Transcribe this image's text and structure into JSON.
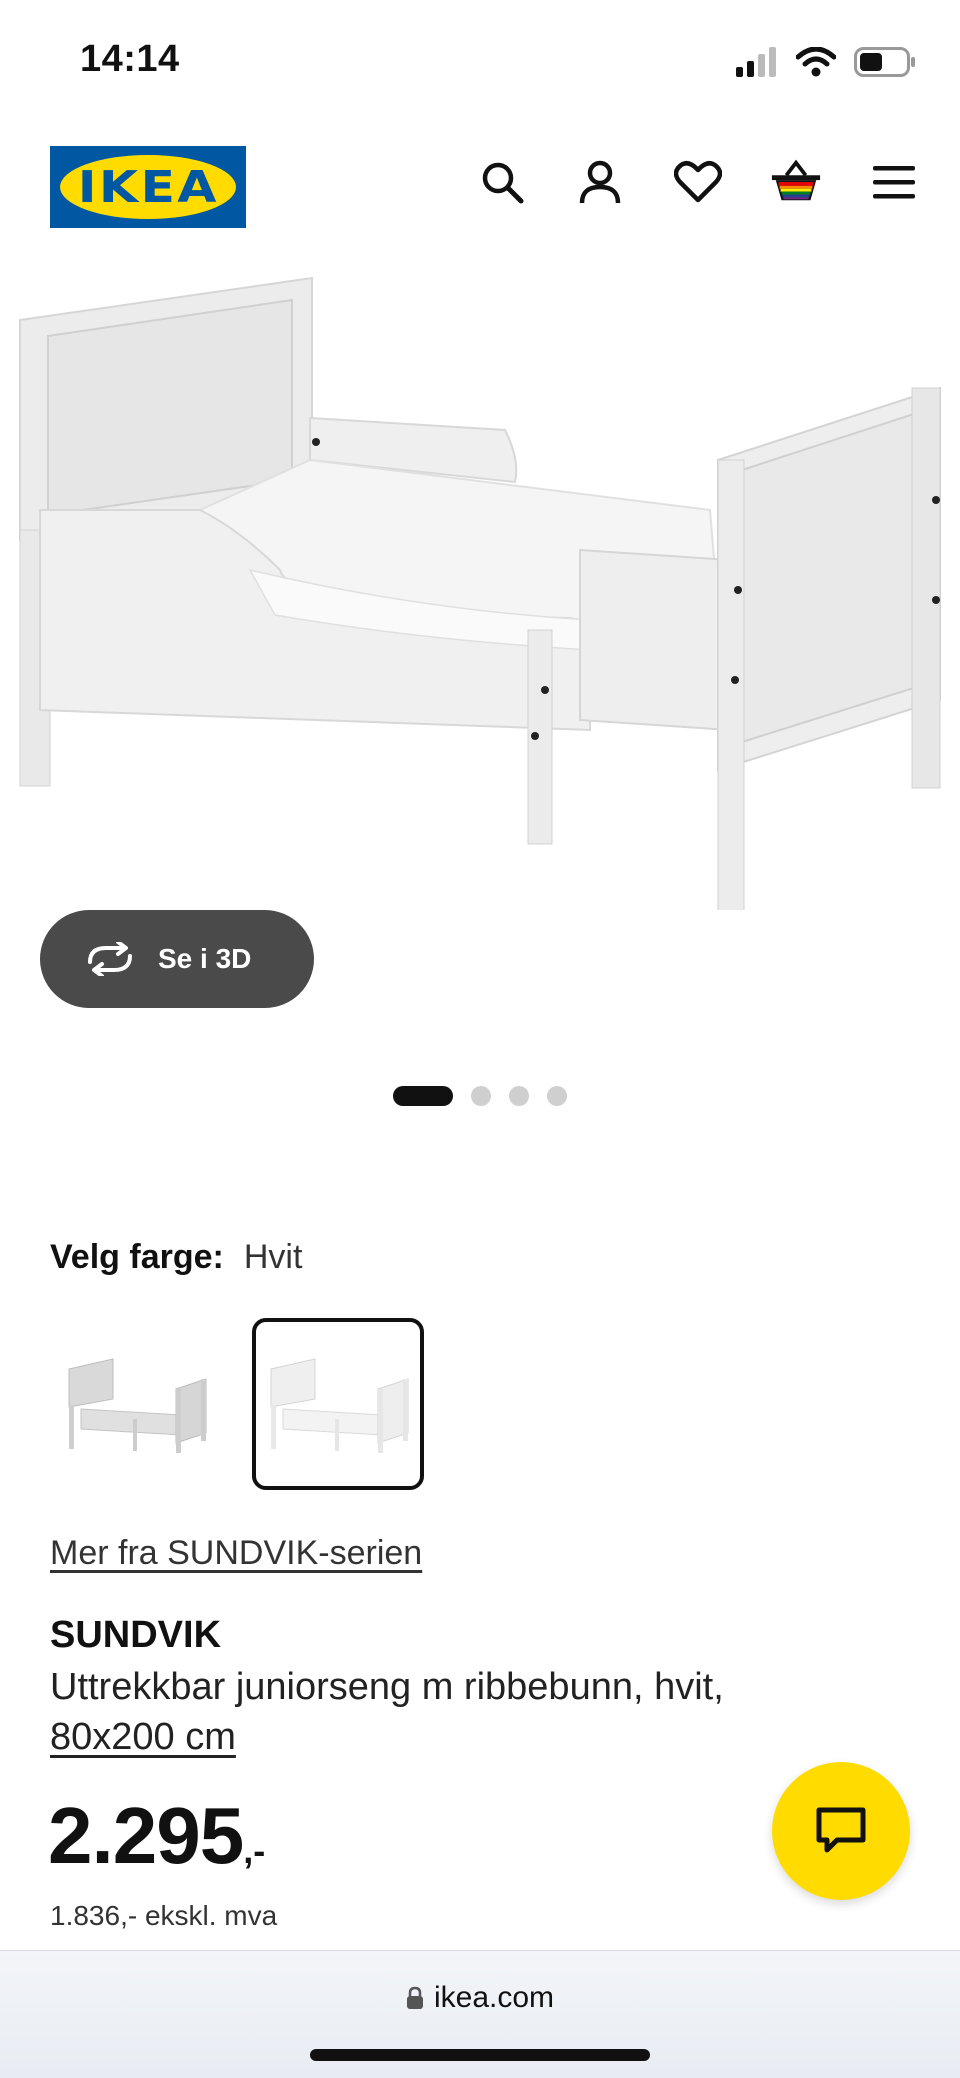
{
  "status_bar": {
    "time": "14:14",
    "icons": [
      "cellular-signal-icon",
      "wifi-icon",
      "battery-icon"
    ]
  },
  "header": {
    "logo_text": "IKEA",
    "icons": [
      "search-icon",
      "account-icon",
      "heart-icon",
      "shopping-basket-icon",
      "menu-icon"
    ],
    "colors": {
      "brand_blue": "#0058a3",
      "brand_yellow": "#ffdb00"
    }
  },
  "gallery": {
    "view3d_label": "Se i 3D",
    "dots": 4,
    "active_dot": 1
  },
  "color_selector": {
    "label": "Velg farge:",
    "value": "Hvit",
    "swatches": [
      "grey variant",
      "white variant"
    ],
    "selected_index": 1
  },
  "series_link": "Mer fra SUNDVIK-serien",
  "product": {
    "name": "SUNDVIK",
    "description": "Uttrekkbar juniorseng m ribbebunn, hvit,",
    "size": "80x200 cm",
    "price": "2.295",
    "price_suffix": ",-",
    "price_ex_vat": "1.836,- ekskl. mva"
  },
  "browser": {
    "url": "ikea.com"
  }
}
